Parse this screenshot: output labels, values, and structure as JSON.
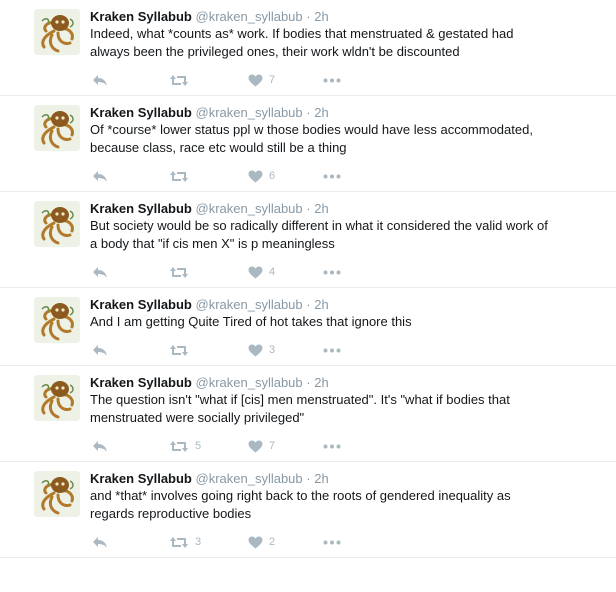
{
  "colors": {
    "name": "#14171a",
    "meta": "#8899a6",
    "icon": "#aab8c2",
    "divider": "#e6ecf0"
  },
  "icons": [
    "reply-icon",
    "retweet-icon",
    "heart-icon",
    "more-icon"
  ],
  "tweets": [
    {
      "name": "Kraken Syllabub",
      "handle": "@kraken_syllabub",
      "separator": "·",
      "time": "2h",
      "lines": [
        "Indeed, what *counts as* work. If bodies that menstruated & gestated had",
        "always been the privileged ones, their work wldn't be discounted"
      ],
      "retweets": "",
      "likes": "7"
    },
    {
      "name": "Kraken Syllabub",
      "handle": "@kraken_syllabub",
      "separator": "·",
      "time": "2h",
      "lines": [
        "Of *course* lower status ppl w those bodies would have less accommodated,",
        "because class, race etc would still be a thing"
      ],
      "retweets": "",
      "likes": "6"
    },
    {
      "name": "Kraken Syllabub",
      "handle": "@kraken_syllabub",
      "separator": "·",
      "time": "2h",
      "lines": [
        "But society would be so radically different in what it considered the valid work of",
        "a body that \"if cis men X\" is p meaningless"
      ],
      "retweets": "",
      "likes": "4"
    },
    {
      "name": "Kraken Syllabub",
      "handle": "@kraken_syllabub",
      "separator": "·",
      "time": "2h",
      "lines": [
        "And I am getting Quite Tired of hot takes that ignore this"
      ],
      "retweets": "",
      "likes": "3"
    },
    {
      "name": "Kraken Syllabub",
      "handle": "@kraken_syllabub",
      "separator": "·",
      "time": "2h",
      "lines": [
        "The question isn't \"what if [cis] men menstruated\". It's \"what if bodies that",
        "menstruated were socially privileged\""
      ],
      "retweets": "5",
      "likes": "7"
    },
    {
      "name": "Kraken Syllabub",
      "handle": "@kraken_syllabub",
      "separator": "·",
      "time": "2h",
      "lines": [
        "and *that* involves going right back to the roots of gendered inequality as",
        "regards reproductive bodies"
      ],
      "retweets": "3",
      "likes": "2"
    }
  ]
}
